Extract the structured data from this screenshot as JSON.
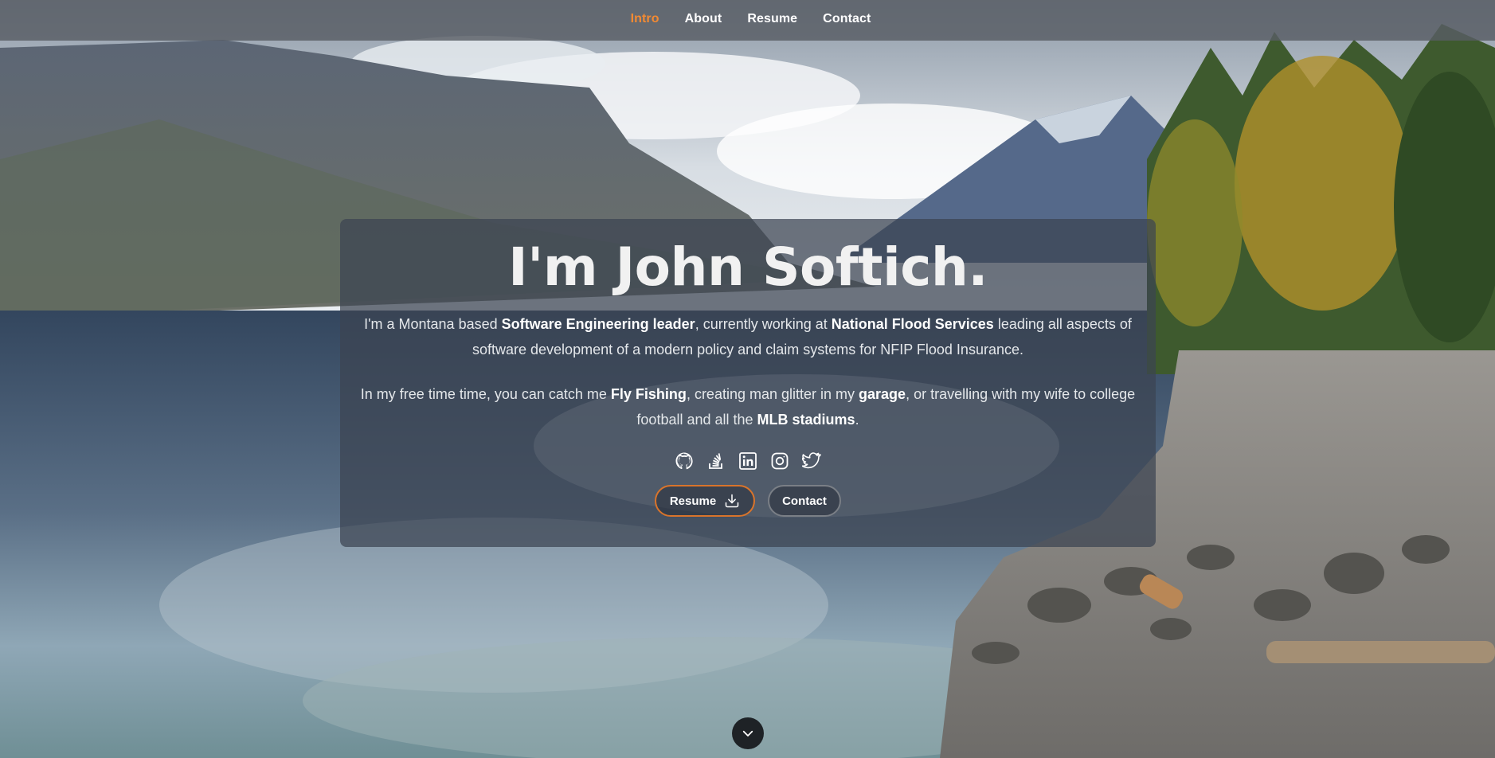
{
  "nav": {
    "items": [
      {
        "label": "Intro",
        "active": true
      },
      {
        "label": "About",
        "active": false
      },
      {
        "label": "Resume",
        "active": false
      },
      {
        "label": "Contact",
        "active": false
      }
    ]
  },
  "hero": {
    "title": "I'm John Softich.",
    "intro": {
      "t1": "I'm a Montana based ",
      "b1": "Software Engineering leader",
      "t2": ", currently working at ",
      "b2": "National Flood Services",
      "t3": " leading all aspects of software development of a modern policy and claim systems for NFIP Flood Insurance."
    },
    "hobbies": {
      "t1": "In my free time time, you can catch me ",
      "b1": "Fly Fishing",
      "t2": ", creating man glitter in my ",
      "b2": "garage",
      "t3": ", or travelling with my wife to college football and all the ",
      "b3": "MLB stadiums",
      "t4": "."
    },
    "socials": [
      "github-icon",
      "stack-overflow-icon",
      "linkedin-icon",
      "instagram-icon",
      "twitter-icon"
    ],
    "buttons": {
      "resume_label": "Resume",
      "contact_label": "Contact"
    }
  },
  "colors": {
    "accent": "#f28a33",
    "nav_bg": "#585d64",
    "card_bg": "#3c4452",
    "resume_border": "#d9742b"
  }
}
